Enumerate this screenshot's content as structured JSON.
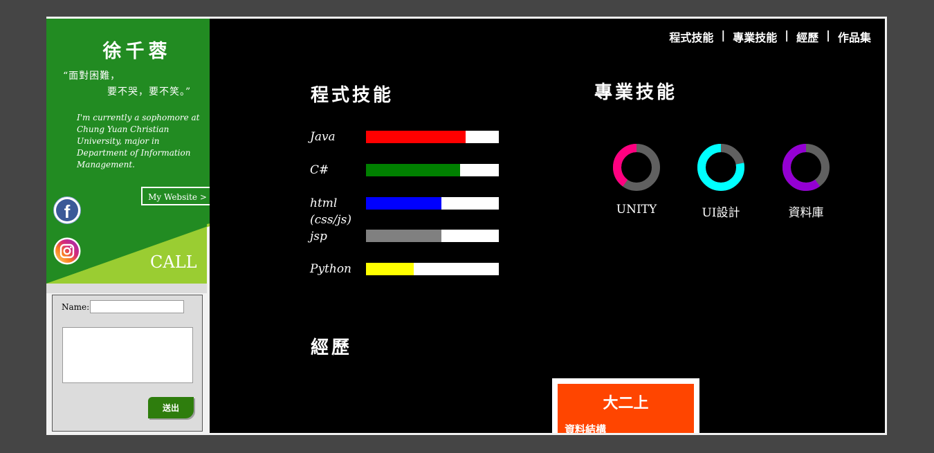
{
  "profile": {
    "name": "徐千蓉",
    "quote_line1": "“面對困難，",
    "quote_line2": "要不哭，要不笑。”",
    "bio": "I'm currently a sophomore at Chung Yuan Christian University, major in Department of Information Management.",
    "website_button": "My Website >",
    "call_label": "CALL"
  },
  "social": [
    {
      "icon": "facebook-icon",
      "glyph": "f"
    },
    {
      "icon": "instagram-icon"
    }
  ],
  "contact": {
    "name_label": "Name:",
    "name_value": "",
    "message_value": "",
    "send_label": "送出"
  },
  "nav": {
    "items": [
      "程式技能",
      "專業技能",
      "經歷",
      "作品集"
    ],
    "separator": "|"
  },
  "sections": {
    "programming": "程式技能",
    "professional": "專業技能",
    "experience": "經歷"
  },
  "programming_skills": [
    {
      "label": "Java",
      "level": 0.75,
      "color": "#ff0000"
    },
    {
      "label": "C#",
      "level": 0.71,
      "color": "#008000"
    },
    {
      "label": "html (css/js)",
      "level": 0.57,
      "color": "#0000ff"
    },
    {
      "label": "jsp",
      "level": 0.57,
      "color": "#808080"
    },
    {
      "label": "Python",
      "level": 0.36,
      "color": "#ffff00"
    }
  ],
  "professional_skills": [
    {
      "label": "UNITY",
      "level": 0.4,
      "color": "#ff0080"
    },
    {
      "label": "UI設計",
      "level": 0.78,
      "color": "#00ffff"
    },
    {
      "label": "資料庫",
      "level": 0.6,
      "color": "#9400d3"
    }
  ],
  "experience_card": {
    "title": "大二上",
    "subtitle": "資料結構"
  },
  "colors": {
    "page_bg": "#454545",
    "sidebar_green": "#228b22",
    "sidebar_lime": "#9acd32",
    "ring_track": "#606060",
    "card_orange": "#ff4500"
  }
}
